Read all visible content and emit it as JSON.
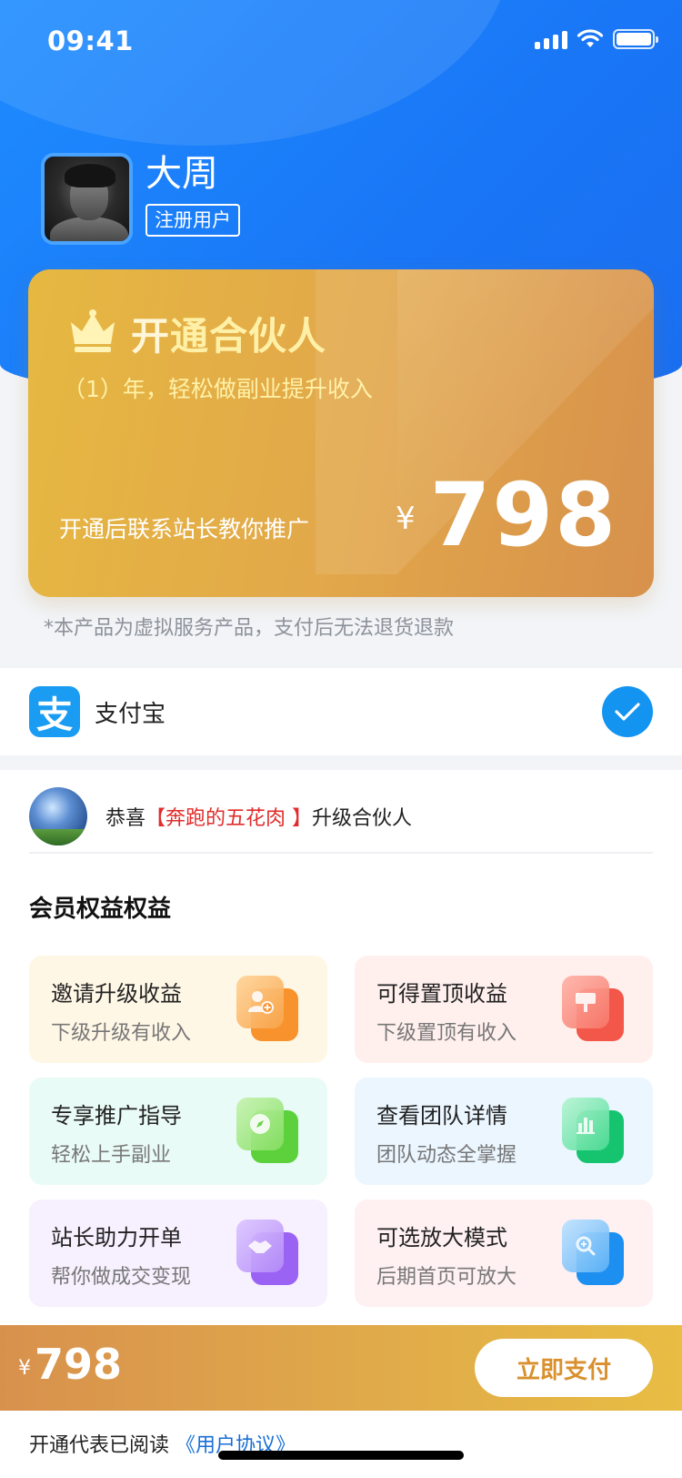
{
  "status_bar": {
    "time": "09:41"
  },
  "profile": {
    "name": "大周",
    "badge": "注册用户"
  },
  "vip_card": {
    "title_start": "开",
    "title_highlight": "通合",
    "title_end": "伙人",
    "subtitle": "（1）年，轻松做副业提升收入",
    "note": "开通后联系站长教你推广",
    "currency": "¥",
    "price": "798"
  },
  "disclaimer": "*本产品为虚拟服务产品，支付后无法退货退款",
  "payment": {
    "method_label": "支付宝",
    "logo_glyph": "支",
    "selected": true
  },
  "ticker": {
    "prefix": "恭喜",
    "name": "【奔跑的五花肉 】",
    "suffix": "升级合伙人"
  },
  "benefits": {
    "section_title": "会员权益权益",
    "items": [
      {
        "title": "邀请升级收益",
        "sub": "下级升级有收入",
        "icon": "add-user-icon",
        "bg": "#fff7e6",
        "icon_color": "#f7922c"
      },
      {
        "title": "可得置顶收益",
        "sub": "下级置顶有收入",
        "icon": "pin-top-icon",
        "bg": "#fff0ee",
        "icon_color": "#f3574a"
      },
      {
        "title": "专享推广指导",
        "sub": "轻松上手副业",
        "icon": "compass-icon",
        "bg": "#e9fbf6",
        "icon_color": "#5cd13c"
      },
      {
        "title": "查看团队详情",
        "sub": "团队动态全掌握",
        "icon": "team-chart-icon",
        "bg": "#ebf6ff",
        "icon_color": "#16c470"
      },
      {
        "title": "站长助力开单",
        "sub": "帮你做成交变现",
        "icon": "handshake-icon",
        "bg": "#f6f0ff",
        "icon_color": "#9a63f3"
      },
      {
        "title": "可选放大模式",
        "sub": "后期首页可放大",
        "icon": "zoom-shield-icon",
        "bg": "#fff0f2",
        "icon_color": "#1d8ff0"
      }
    ]
  },
  "bottom_bar": {
    "currency": "¥",
    "price": "798",
    "pay_button": "立即支付"
  },
  "agreement": {
    "text": "开通代表已阅读",
    "link": "《用户协议》"
  }
}
